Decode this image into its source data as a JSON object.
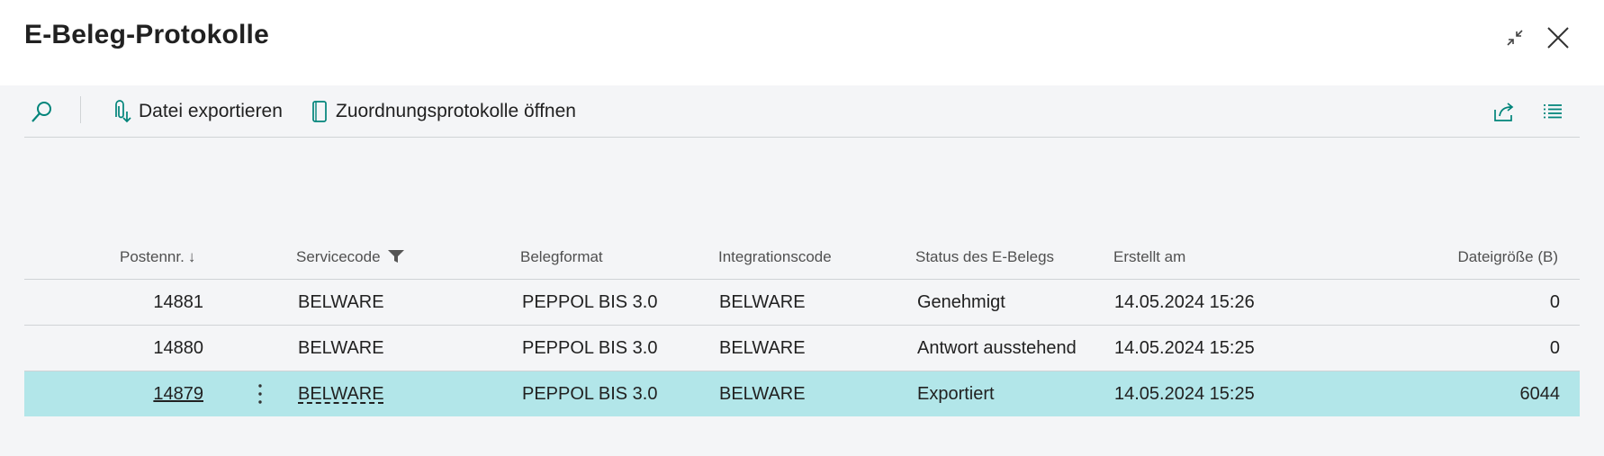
{
  "page": {
    "title": "E-Beleg-Protokolle"
  },
  "header_actions": {
    "collapse": "collapse-icon",
    "close": "close-icon"
  },
  "toolbar": {
    "search_icon": "search-icon",
    "export_label": "Datei exportieren",
    "mapping_label": "Zuordnungsprotokolle öffnen",
    "share_icon": "share-icon",
    "list_icon": "list-view-icon"
  },
  "table": {
    "columns": [
      {
        "label": "Postennr.",
        "sort": "descending"
      },
      {
        "label": "Servicecode",
        "filtered": true
      },
      {
        "label": "Belegformat"
      },
      {
        "label": "Integrationscode"
      },
      {
        "label": "Status des E-Belegs"
      },
      {
        "label": "Erstellt am"
      },
      {
        "label": "Dateigröße (B)"
      }
    ],
    "rows": [
      {
        "entry_no": "14881",
        "service_code": "BELWARE",
        "format": "PEPPOL BIS 3.0",
        "integration_code": "BELWARE",
        "status": "Genehmigt",
        "created": "14.05.2024 15:26",
        "file_size": "0",
        "selected": false
      },
      {
        "entry_no": "14880",
        "service_code": "BELWARE",
        "format": "PEPPOL BIS 3.0",
        "integration_code": "BELWARE",
        "status": "Antwort ausstehend",
        "created": "14.05.2024 15:25",
        "file_size": "0",
        "selected": false
      },
      {
        "entry_no": "14879",
        "service_code": "BELWARE",
        "format": "PEPPOL BIS 3.0",
        "integration_code": "BELWARE",
        "status": "Exportiert",
        "created": "14.05.2024 15:25",
        "file_size": "6044",
        "selected": true
      }
    ]
  },
  "colors": {
    "accent": "#00847a",
    "selected_row": "#b2e6e9",
    "background": "#f4f5f7"
  }
}
